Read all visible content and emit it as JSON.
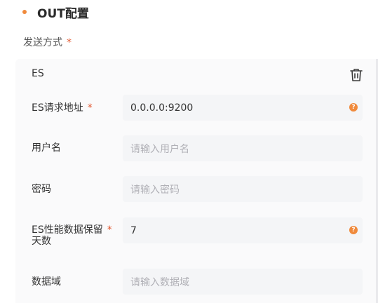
{
  "section": {
    "title": "OUT配置"
  },
  "send_method": {
    "label": "发送方式",
    "required_mark": "*"
  },
  "output_card": {
    "title": "ES",
    "delete_icon": "trash-icon",
    "fields": [
      {
        "label": "ES请求地址",
        "required_mark": "*",
        "value": "0.0.0.0:9200",
        "placeholder": "",
        "help_icon": "?"
      },
      {
        "label": "用户名",
        "required_mark": "",
        "value": "",
        "placeholder": "请输入用户名",
        "help_icon": ""
      },
      {
        "label": "密码",
        "required_mark": "",
        "value": "",
        "placeholder": "请输入密码",
        "help_icon": ""
      },
      {
        "label_line1": "ES性能数据保留",
        "label_line2": "天数",
        "required_mark": "*",
        "value": "7",
        "placeholder": "",
        "help_icon": "?"
      },
      {
        "label": "数据域",
        "required_mark": "",
        "value": "",
        "placeholder": "请输入数据域",
        "help_icon": ""
      }
    ]
  },
  "colors": {
    "accent": "#f08a3c",
    "required": "#e2562e",
    "input_bg": "#f4f5f7",
    "card_bg": "#fafafb",
    "placeholder": "#b0b0b6"
  }
}
